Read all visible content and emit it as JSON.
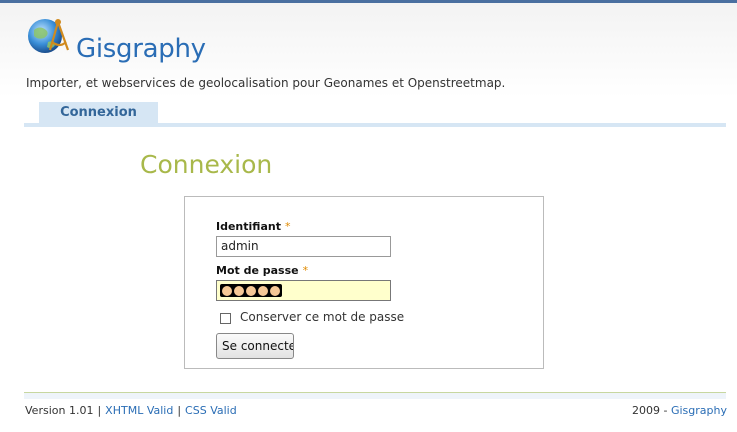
{
  "header": {
    "brand": "Gisgraphy",
    "tagline": "Importer, et webservices de geolocalisation pour Geonames et Openstreetmap."
  },
  "tabs": [
    {
      "label": "Connexion"
    }
  ],
  "main": {
    "title": "Connexion",
    "form": {
      "username_label": "Identifiant",
      "username_value": "admin",
      "password_label": "Mot de passe",
      "password_dots": 5,
      "required_mark": "*",
      "remember_label": "Conserver ce mot de passe",
      "remember_checked": false,
      "submit_label": "Se connecter"
    }
  },
  "footer": {
    "version": "Version 1.01",
    "separator": "|",
    "xhtml": "XHTML Valid",
    "css": "CSS Valid",
    "year": "2009 -",
    "brand": "Gisgraphy"
  },
  "colors": {
    "brand": "#2a6db5",
    "title": "#a8b84a",
    "tab": "#d6e6f4",
    "password_bg": "#ffffcc"
  },
  "icons": {
    "logo": "globe-compass-icon"
  }
}
